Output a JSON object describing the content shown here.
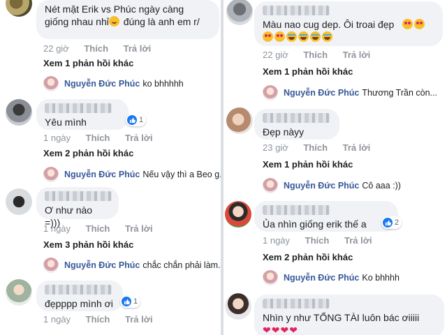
{
  "actions": {
    "like": "Thích",
    "reply": "Trả lời"
  },
  "left_column": {
    "comments": [
      {
        "text": "Nét mặt Erik vs Phúc ngày càng\ngiống nhau nhỉ",
        "text_after_emoji": " đúng là anh em r/",
        "emoji": "grin-icon",
        "time": "22 giờ",
        "replies_link": "Xem 1 phản hồi khác",
        "reply": {
          "name": "Nguyễn Đức Phúc",
          "text": "ko bhhhhh"
        }
      },
      {
        "text": "Yêu mình",
        "time": "1 ngày",
        "likes": "1",
        "replies_link": "Xem 2 phản hồi khác",
        "reply": {
          "name": "Nguyễn Đức Phúc",
          "text": "Nếu vậy thì a Beo g..."
        }
      },
      {
        "text": "Ơ như nào =)))",
        "time": "1 ngày",
        "replies_link": "Xem 3 phản hồi khác",
        "reply": {
          "name": "Nguyễn Đức Phúc",
          "text": "chắc chắn phải làm..."
        }
      },
      {
        "text": "đẹpppp mình ơi",
        "time": "1 ngày",
        "likes": "1"
      }
    ]
  },
  "right_column": {
    "comments": [
      {
        "text": "Màu nao cug dep. Ôi troai đẹp",
        "time": "22 giờ",
        "replies_link": "Xem 1 phản hồi khác",
        "reply": {
          "name": "Nguyễn Đức Phúc",
          "text": "Thương Trần còn..."
        }
      },
      {
        "text": "Đẹp nàyy",
        "time": "23 giờ",
        "replies_link": "Xem 1 phản hồi khác",
        "reply": {
          "name": "Nguyễn Đức Phúc",
          "text": "Cô aaa :))"
        }
      },
      {
        "text": "Ủa nhìn giống erik thế a",
        "time": "1 ngày",
        "likes": "2",
        "replies_link": "Xem 2 phản hồi khác",
        "reply": {
          "name": "Nguyễn Đức Phúc",
          "text": "Ko bhhhh"
        }
      },
      {
        "text": "Nhìn y như TỔNG TÀI luôn bác ơiiiii"
      }
    ]
  },
  "colors": {
    "bubble": "#f0f2f5",
    "like_blue": "#1877f2",
    "name_link": "#385898",
    "meta_gray": "#8d949e"
  }
}
